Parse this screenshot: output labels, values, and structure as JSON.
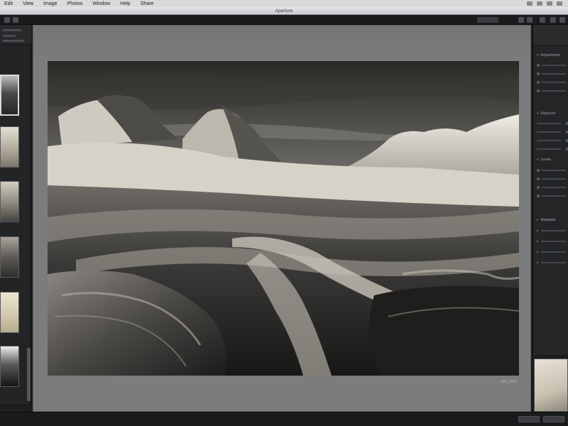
{
  "os_menu": {
    "items": [
      "Edit",
      "View",
      "Image",
      "Photos",
      "Window",
      "Help",
      "Share"
    ]
  },
  "window": {
    "title": "Aperture"
  },
  "viewer": {
    "photo_alt": "black and white desert sandstone landscape",
    "caption": "IMG_0412"
  },
  "filmstrip": {
    "thumbnails": [
      {
        "tone": "#3a3a3a",
        "selected": true
      },
      {
        "tone": "#c9c3b3",
        "selected": false
      },
      {
        "tone": "#8f8a80",
        "selected": false
      },
      {
        "tone": "#6d6a66",
        "selected": false
      },
      {
        "tone": "#d8d0b8",
        "selected": false
      },
      {
        "tone": "#2d2d2d",
        "selected": false
      }
    ]
  },
  "inspector": {
    "sections": [
      {
        "label": "Adjustments"
      },
      {
        "label": "Exposure"
      },
      {
        "label": "Levels"
      },
      {
        "label": "Metadata"
      }
    ],
    "rows": [
      "Exposure",
      "Recovery",
      "Black",
      "Brightness",
      "Contrast",
      "Definition",
      "Saturation",
      "Vibrancy",
      "Highlights",
      "Shadows",
      "Sharpen",
      "Edge"
    ]
  },
  "colors": {
    "accent": "#d8d8d8",
    "panel": "#242527",
    "viewer_bg": "#7b7c7d"
  }
}
